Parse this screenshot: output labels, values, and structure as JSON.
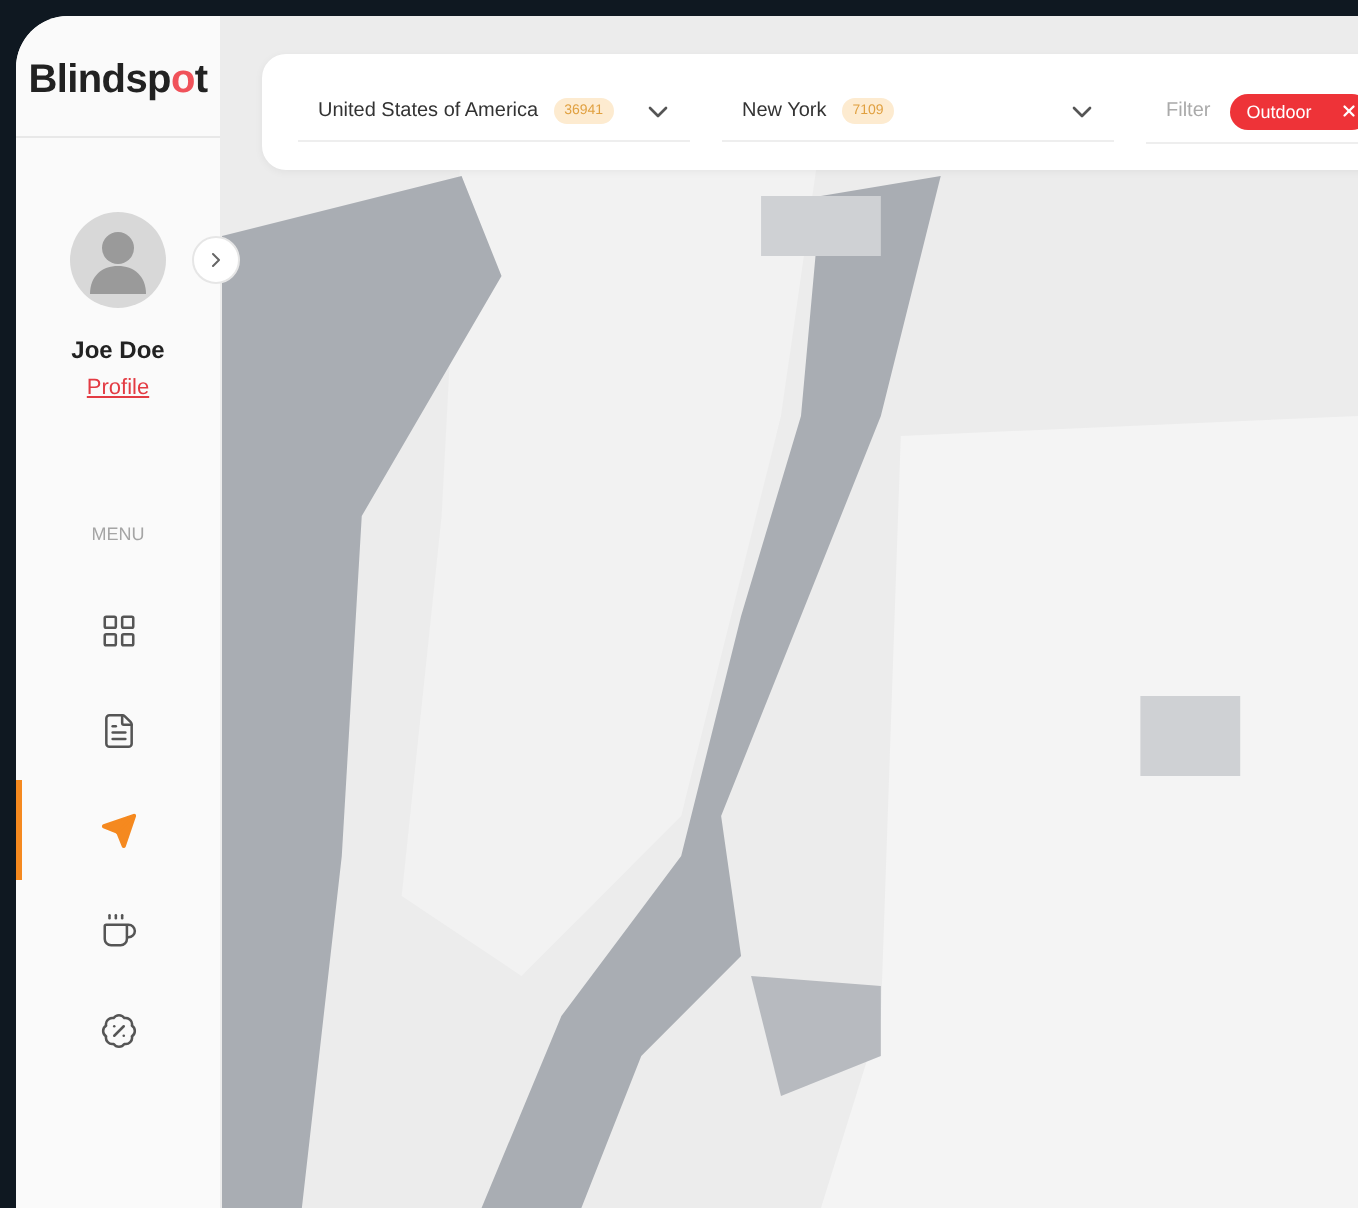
{
  "logo": {
    "before": "Blindsp",
    "accent": "o",
    "after": "t"
  },
  "user": {
    "name": "Joe Doe",
    "link": "Profile"
  },
  "menu": {
    "title": "MENU",
    "items": [
      {
        "selected": false
      },
      {
        "selected": false
      },
      {
        "selected": true
      },
      {
        "selected": false
      },
      {
        "selected": false
      }
    ]
  },
  "filters": {
    "country": {
      "value": "United States of America",
      "count": "36941"
    },
    "city": {
      "value": "New York",
      "count": "7109"
    },
    "filter": {
      "label": "Filter",
      "tags": [
        "Outdoor"
      ]
    }
  }
}
